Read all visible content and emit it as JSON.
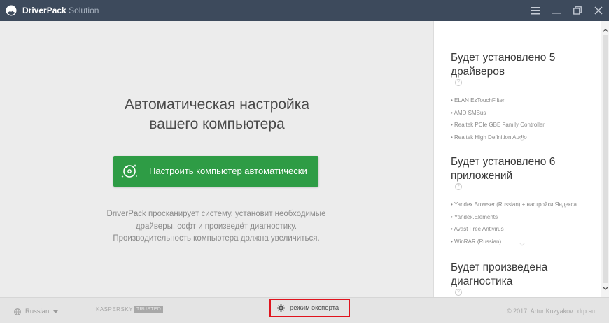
{
  "titlebar": {
    "app_name": "DriverPack",
    "app_suffix": "Solution"
  },
  "main": {
    "headline_line1": "Автоматическая настройка",
    "headline_line2": "вашего компьютера",
    "auto_button_label": "Настроить компьютер автоматически",
    "description_line1": "DriverPack просканирует систему, установит необходимые",
    "description_line2": "драйверы, софт и произведёт диагностику.",
    "description_line3": "Производительность компьютера должна увеличиться."
  },
  "panel": {
    "drivers": {
      "title_line1": "Будет установлено 5",
      "title_line2": "драйверов",
      "items": [
        "• ELAN EzTouchFilter",
        "• AMD SMBus",
        "• Realtek PCIe GBE Family Controller",
        "• Realtek High Definition Audio"
      ]
    },
    "apps": {
      "title_line1": "Будет установлено 6",
      "title_line2": "приложений",
      "items": [
        "• Yandex.Browser (Russian) + настройки Яндекса",
        "• Yandex.Elements",
        "• Avast Free Antivirus",
        "• WinRAR (Russian)"
      ]
    },
    "diagnostics": {
      "title_line1": "Будет произведена",
      "title_line2": "диагностика"
    },
    "help_glyph": "?"
  },
  "footer": {
    "language": "Russian",
    "kaspersky": "KASPERSKY",
    "kaspersky_badge": "TRUSTED",
    "expert_mode_label": "режим эксперта",
    "copyright": "© 2017, Artur Kuzyakov",
    "site": "drp.su"
  },
  "colors": {
    "titlebar": "#3d4a5c",
    "accent_green": "#2e9c45",
    "highlight_red": "#e0141e"
  },
  "icons": {
    "logo": "driverpack-logo-icon",
    "button": "disc-sparkle-icon",
    "menu": "hamburger-icon",
    "minimize": "minimize-icon",
    "maximize": "restore-icon",
    "close": "close-icon",
    "language": "globe-icon",
    "expert": "gear-icon"
  }
}
